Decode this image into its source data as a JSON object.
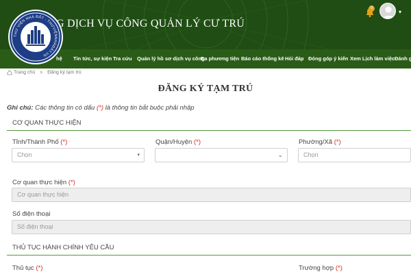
{
  "header": {
    "site_title": "G DỊCH VỤ CÔNG QUẢN LÝ CƯ TRÚ",
    "notification_count": "0",
    "colors": {
      "header_bg": "#1f4d14",
      "nav_bg": "#2a5c18",
      "accent": "#4f9a3c",
      "required": "#d9291c"
    }
  },
  "logo": {
    "text": "THƯ VIỆN NHÀ ĐẤT · THƯVIỆNNHÀĐẤT.VN"
  },
  "nav": {
    "items": [
      {
        "label": "hệ"
      },
      {
        "label": "Tin tức, sự kiện"
      },
      {
        "label": "Tra cứu"
      },
      {
        "label": "Quản lý hồ sơ dịch vụ công"
      },
      {
        "label": "Đa phương tiện"
      },
      {
        "label": "Báo cáo thống kê"
      },
      {
        "label": "Hỏi đáp"
      },
      {
        "label": "Đóng góp ý kiến"
      },
      {
        "label": "Xem Lịch làm việc"
      },
      {
        "label": "Đánh gi"
      }
    ]
  },
  "breadcrumb": {
    "home": "Trang chủ",
    "separator": ">",
    "current": "Đăng ký tạm trú"
  },
  "page": {
    "title": "ĐĂNG KÝ TẠM TRÚ",
    "note_label": "Ghi chú:",
    "note_text_before": "Các thông tin có dấu",
    "note_mark": "(*)",
    "note_text_after": "là thông tin bắt buộc phải nhập"
  },
  "section1": {
    "title": "CƠ QUAN THỰC HIỆN",
    "province": {
      "label": "Tỉnh/Thành Phố",
      "value": "Chọn"
    },
    "district": {
      "label": "Quận/Huyện",
      "value": ""
    },
    "ward": {
      "label": "Phường/Xã",
      "value": "Chọn"
    },
    "agency": {
      "label": "Cơ quan thực hiện",
      "placeholder": "Cơ quan thực hiện"
    },
    "phone": {
      "label": "Số điện thoại",
      "placeholder": "Số điện thoại"
    }
  },
  "section2": {
    "title": "THỦ TỤC HÀNH CHÍNH YÊU CẦU",
    "procedure": {
      "label": "Thủ tục"
    },
    "case": {
      "label": "Trường hợp"
    }
  },
  "required_mark": "(*)"
}
